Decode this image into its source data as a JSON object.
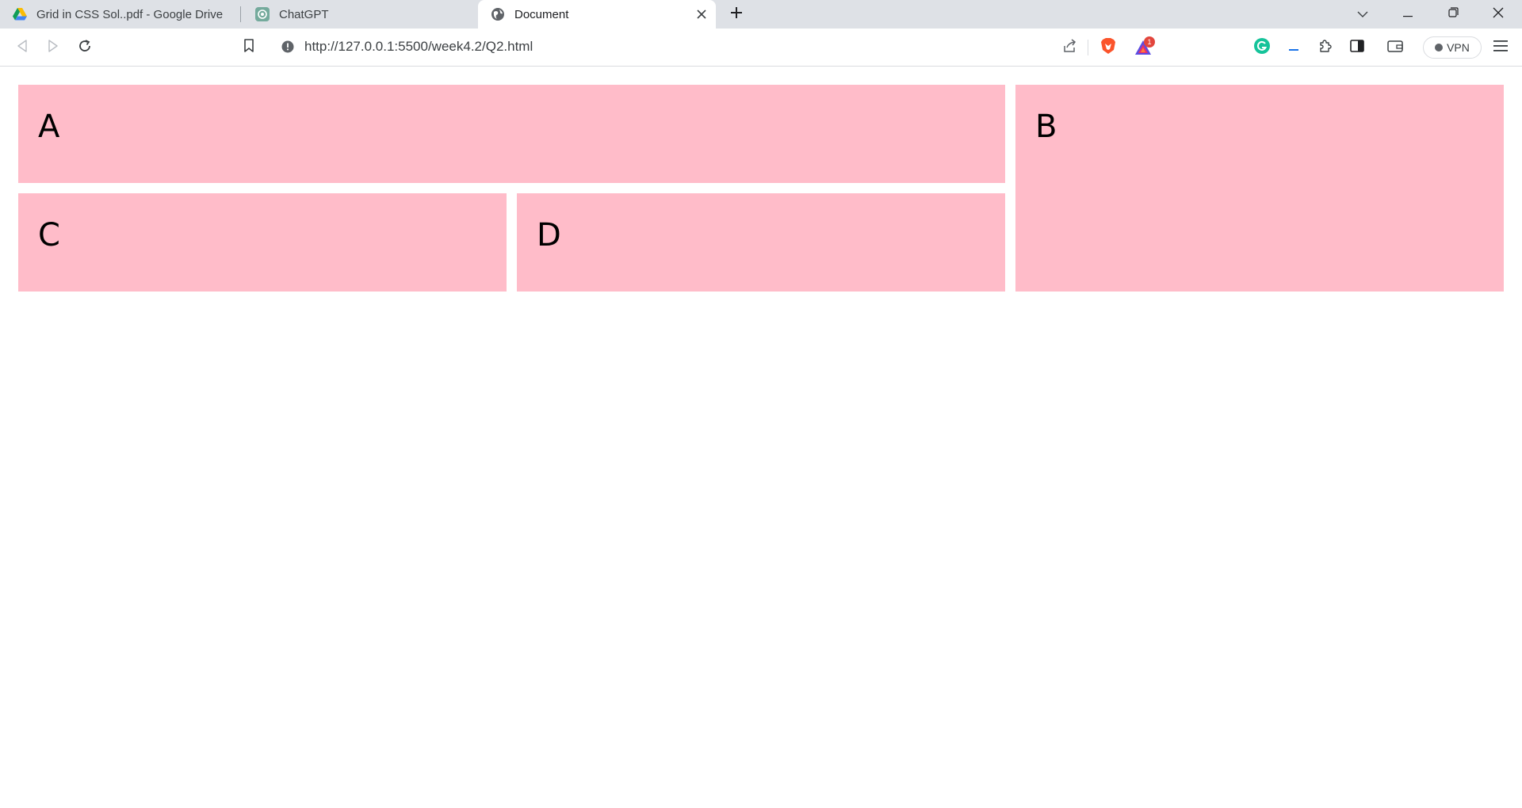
{
  "browser": {
    "tabs": [
      {
        "title": "Grid in CSS Sol..pdf - Google Drive",
        "icon": "google-drive-icon",
        "active": false
      },
      {
        "title": "ChatGPT",
        "icon": "chatgpt-icon",
        "active": false
      },
      {
        "title": "Document",
        "icon": "globe-icon",
        "active": true
      }
    ],
    "address_bar": {
      "url": "http://127.0.0.1:5500/week4.2/Q2.html"
    },
    "notification_count": "1",
    "vpn_label": "VPN",
    "colors": {
      "tab_strip": "#dee1e6",
      "brave_orange": "#fb542b",
      "grammarly_green": "#15c39a"
    }
  },
  "page": {
    "cells": {
      "a": "A",
      "b": "B",
      "c": "C",
      "d": "D"
    },
    "cell_color": "#ffbcc9"
  }
}
